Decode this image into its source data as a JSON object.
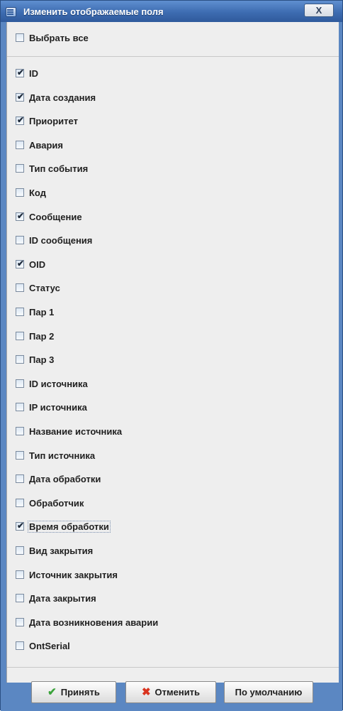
{
  "window": {
    "title": "Изменить отображаемые поля",
    "close_symbol": "X"
  },
  "select_all": {
    "label": "Выбрать все",
    "checked": false
  },
  "fields": [
    {
      "label": "ID",
      "checked": true
    },
    {
      "label": "Дата создания",
      "checked": true
    },
    {
      "label": "Приоритет",
      "checked": true
    },
    {
      "label": "Авария",
      "checked": false
    },
    {
      "label": "Тип события",
      "checked": false
    },
    {
      "label": "Код",
      "checked": false
    },
    {
      "label": "Сообщение",
      "checked": true
    },
    {
      "label": "ID сообщения",
      "checked": false
    },
    {
      "label": "OID",
      "checked": true
    },
    {
      "label": "Статус",
      "checked": false
    },
    {
      "label": "Пар 1",
      "checked": false
    },
    {
      "label": "Пар 2",
      "checked": false
    },
    {
      "label": "Пар 3",
      "checked": false
    },
    {
      "label": "ID источника",
      "checked": false
    },
    {
      "label": "IP источника",
      "checked": false
    },
    {
      "label": "Название источника",
      "checked": false
    },
    {
      "label": "Тип источника",
      "checked": false
    },
    {
      "label": "Дата обработки",
      "checked": false
    },
    {
      "label": "Обработчик",
      "checked": false
    },
    {
      "label": "Время обработки",
      "checked": true,
      "focused": true
    },
    {
      "label": "Вид закрытия",
      "checked": false
    },
    {
      "label": "Источник закрытия",
      "checked": false
    },
    {
      "label": "Дата закрытия",
      "checked": false
    },
    {
      "label": "Дата возникновения аварии",
      "checked": false
    },
    {
      "label": "OntSerial",
      "checked": false
    }
  ],
  "buttons": {
    "accept": {
      "label": "Принять",
      "icon": "checkmark-icon"
    },
    "cancel": {
      "label": "Отменить",
      "icon": "x-icon"
    },
    "default": {
      "label": "По умолчанию"
    }
  },
  "colors": {
    "titlebar": "#3d6cb1",
    "panel": "#eeeeee",
    "accept_icon": "#3aa33a",
    "cancel_icon": "#d9341f"
  }
}
